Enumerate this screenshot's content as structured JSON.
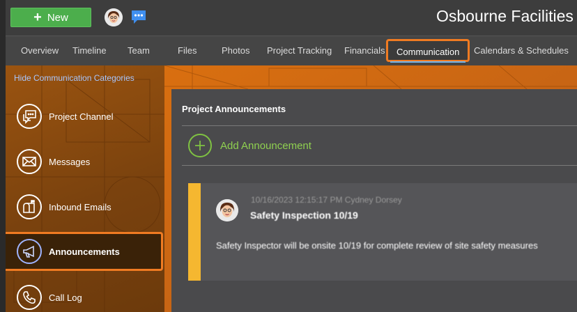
{
  "header": {
    "new_button_label": "New",
    "company_name": "Osbourne Facilities"
  },
  "tabs": [
    {
      "label": "Overview"
    },
    {
      "label": "Timeline"
    },
    {
      "label": "Team"
    },
    {
      "label": "Files"
    },
    {
      "label": "Photos"
    },
    {
      "label": "Project Tracking"
    },
    {
      "label": "Financials"
    },
    {
      "label": "Communication",
      "active": true
    },
    {
      "label": "Calendars & Schedules"
    }
  ],
  "sidebar": {
    "hide_link": "Hide Communication Categories",
    "items": [
      {
        "label": "Project Channel",
        "icon": "chat-bubble-icon"
      },
      {
        "label": "Messages",
        "icon": "envelope-icon"
      },
      {
        "label": "Inbound Emails",
        "icon": "mailbox-icon"
      },
      {
        "label": "Announcements",
        "icon": "megaphone-icon",
        "active": true
      },
      {
        "label": "Call Log",
        "icon": "phone-icon"
      }
    ]
  },
  "main": {
    "panel_title": "Project Announcements",
    "add_label": "Add Announcement",
    "announcement": {
      "meta": "10/16/2023 12:15:17 PM Cydney Dorsey",
      "title": "Safety Inspection 10/19",
      "body": "Safety Inspector will be onsite 10/19 for complete review of site safety measures"
    }
  },
  "colors": {
    "accent_highlight": "#f07b22",
    "new_button": "#4cae4c",
    "add_green": "#7fc242",
    "announcement_stripe": "#f5b730"
  }
}
